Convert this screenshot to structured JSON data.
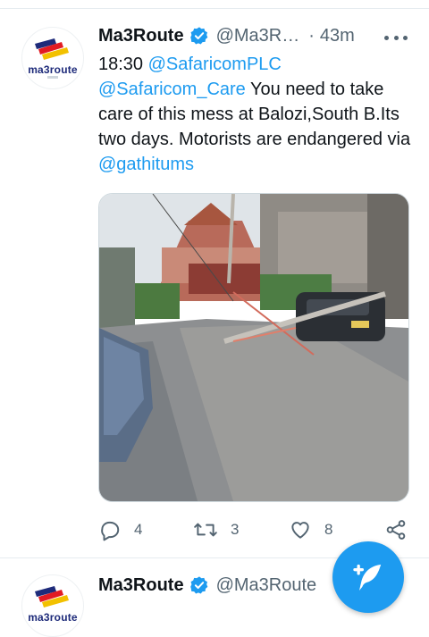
{
  "colors": {
    "accent": "#1d9bf0",
    "secondary_text": "#536471",
    "verified_badge": "#1d9bf0"
  },
  "tweet1": {
    "avatar_text": "ma3route",
    "display_name": "Ma3Route",
    "handle": "@Ma3R…",
    "separator": "·",
    "timestamp": "43m",
    "text": {
      "part1": "18:30 ",
      "mention1": "@SafaricomPLC",
      "mention2": "@Safaricom_Care",
      "part2": " You need to take care of this mess at Balozi,South B.Its two days. Motorists are endangered   via ",
      "mention3": "@gathitums"
    },
    "media_icon": "photo-fallen-power-pole",
    "counts": {
      "replies": "4",
      "retweets": "3",
      "likes": "8"
    }
  },
  "tweet2": {
    "avatar_text": "ma3route",
    "display_name": "Ma3Route",
    "handle": "@Ma3Route"
  },
  "icons": {
    "verified": "verified-badge-icon",
    "more": "more-icon",
    "reply": "reply-icon",
    "retweet": "retweet-icon",
    "like": "heart-icon",
    "share": "share-icon",
    "compose": "compose-tweet-icon"
  }
}
